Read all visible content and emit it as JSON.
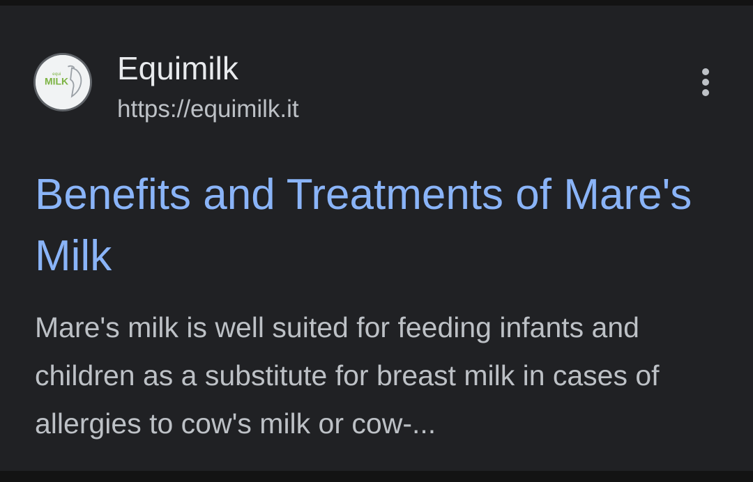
{
  "result": {
    "favicon": {
      "icon": "equimilk-logo-icon",
      "logo_text": "MILK"
    },
    "site_name": "Equimilk",
    "url": "https://equimilk.it",
    "menu_icon": "more-vert-icon",
    "title": "Benefits and Treatments of Mare's Milk",
    "snippet": "Mare's milk is well suited for feeding infants and children as a substitute for breast milk in cases of allergies to cow's milk or cow-..."
  },
  "colors": {
    "background": "#202124",
    "title_link": "#8ab4f8",
    "site_name": "#e8eaed",
    "secondary_text": "#bdc1c6"
  }
}
